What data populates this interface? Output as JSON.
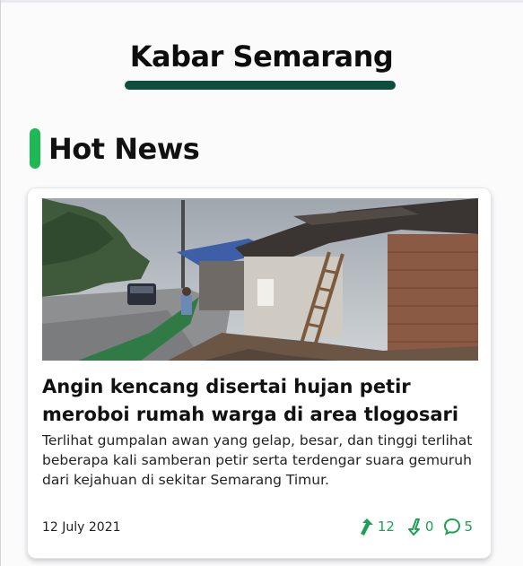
{
  "app": {
    "title": "Kabar Semarang"
  },
  "section": {
    "title": "Hot News"
  },
  "article": {
    "headline": "Angin kencang disertai hujan petir meroboi rumah warga di area tlogosari",
    "excerpt": "Terlihat  gumpalan awan yang gelap, besar, dan tinggi terlihat beberapa kali  samberan petir serta terdengar suara gemuruh dari kejahuan di sekitar Semarang Timur.",
    "date": "12 July 2021",
    "upvotes": "12",
    "downvotes": "0",
    "comments": "5",
    "image": "storm-damaged-house-photo"
  },
  "colors": {
    "accent_dark_green": "#0f4d3c",
    "accent_green": "#1db954",
    "stat_green": "#1f9f55"
  },
  "icons": [
    "upvote-arrow-icon",
    "downvote-arrow-icon",
    "comment-icon"
  ]
}
